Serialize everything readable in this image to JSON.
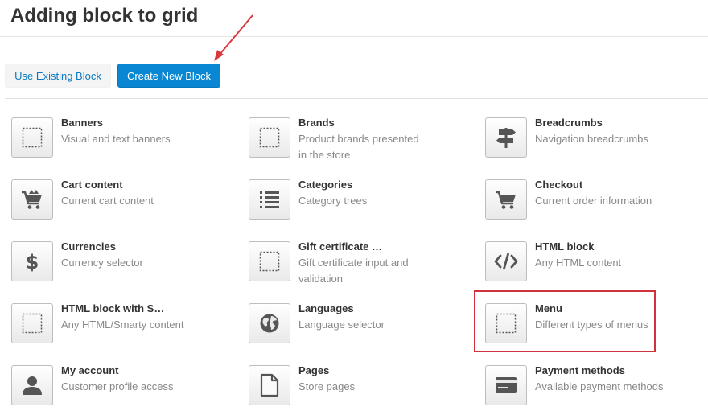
{
  "page": {
    "title": "Adding block to grid"
  },
  "buttons": {
    "use_existing": "Use Existing Block",
    "create_new": "Create New Block"
  },
  "blocks": [
    {
      "name": "Banners",
      "desc": "Visual and text banners",
      "icon": "placeholder-icon"
    },
    {
      "name": "Brands",
      "desc": "Product brands presented in the store",
      "icon": "placeholder-icon"
    },
    {
      "name": "Breadcrumbs",
      "desc": "Navigation breadcrumbs",
      "icon": "signpost-icon"
    },
    {
      "name": "Cart content",
      "desc": "Current cart content",
      "icon": "cart-full-icon"
    },
    {
      "name": "Categories",
      "desc": "Category trees",
      "icon": "list-icon"
    },
    {
      "name": "Checkout",
      "desc": "Current order information",
      "icon": "cart-icon"
    },
    {
      "name": "Currencies",
      "desc": "Currency selector",
      "icon": "dollar-icon"
    },
    {
      "name": "Gift certificate …",
      "desc": "Gift certificate input and validation",
      "icon": "placeholder-icon"
    },
    {
      "name": "HTML block",
      "desc": "Any HTML content",
      "icon": "code-icon"
    },
    {
      "name": "HTML block with S…",
      "desc": "Any HTML/Smarty content",
      "icon": "placeholder-icon"
    },
    {
      "name": "Languages",
      "desc": "Language selector",
      "icon": "globe-icon"
    },
    {
      "name": "Menu",
      "desc": "Different types of menus",
      "icon": "placeholder-icon"
    },
    {
      "name": "My account",
      "desc": "Customer profile access",
      "icon": "user-icon"
    },
    {
      "name": "Pages",
      "desc": "Store pages",
      "icon": "page-icon"
    },
    {
      "name": "Payment methods",
      "desc": "Available payment methods",
      "icon": "credit-card-icon"
    }
  ],
  "colors": {
    "primary": "#0a87d2",
    "link": "#0b7ac2",
    "highlight": "#d0323b",
    "annotation_arrow": "#d9393e"
  }
}
